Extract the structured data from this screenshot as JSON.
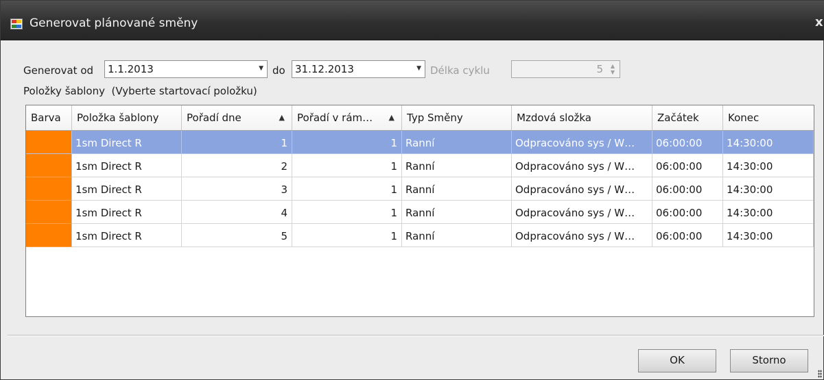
{
  "window": {
    "title": "Generovat plánované směny",
    "close_glyph": "x"
  },
  "form": {
    "from_label": "Generovat od",
    "from_value": "1.1.2013",
    "to_label": "do",
    "to_value": "31.12.2013",
    "cycle_label": "Délka cyklu",
    "cycle_value": "5",
    "section_label": "Položky šablony",
    "section_hint": "(Vyberte startovací položku)"
  },
  "grid": {
    "columns": [
      {
        "label": "Barva"
      },
      {
        "label": "Položka šablony"
      },
      {
        "label": "Pořadí dne",
        "sort": "▲"
      },
      {
        "label": "Pořadí v rám…",
        "sort": "▲"
      },
      {
        "label": "Typ Směny"
      },
      {
        "label": "Mzdová složka"
      },
      {
        "label": "Začátek"
      },
      {
        "label": "Konec"
      }
    ],
    "rows": [
      {
        "color": "#ff8000",
        "item": "1sm Direct R",
        "day_order": "1",
        "frame_order": "1",
        "shift_type": "Ranní",
        "wage": "Odpracováno sys / W…",
        "start": "06:00:00",
        "end": "14:30:00"
      },
      {
        "color": "#ff8000",
        "item": "1sm Direct R",
        "day_order": "2",
        "frame_order": "1",
        "shift_type": "Ranní",
        "wage": "Odpracováno sys / W…",
        "start": "06:00:00",
        "end": "14:30:00"
      },
      {
        "color": "#ff8000",
        "item": "1sm Direct R",
        "day_order": "3",
        "frame_order": "1",
        "shift_type": "Ranní",
        "wage": "Odpracováno sys / W…",
        "start": "06:00:00",
        "end": "14:30:00"
      },
      {
        "color": "#ff8000",
        "item": "1sm Direct R",
        "day_order": "4",
        "frame_order": "1",
        "shift_type": "Ranní",
        "wage": "Odpracováno sys / W…",
        "start": "06:00:00",
        "end": "14:30:00"
      },
      {
        "color": "#ff8000",
        "item": "1sm Direct R",
        "day_order": "5",
        "frame_order": "1",
        "shift_type": "Ranní",
        "wage": "Odpracováno sys / W…",
        "start": "06:00:00",
        "end": "14:30:00"
      }
    ]
  },
  "buttons": {
    "ok": "OK",
    "cancel": "Storno"
  }
}
